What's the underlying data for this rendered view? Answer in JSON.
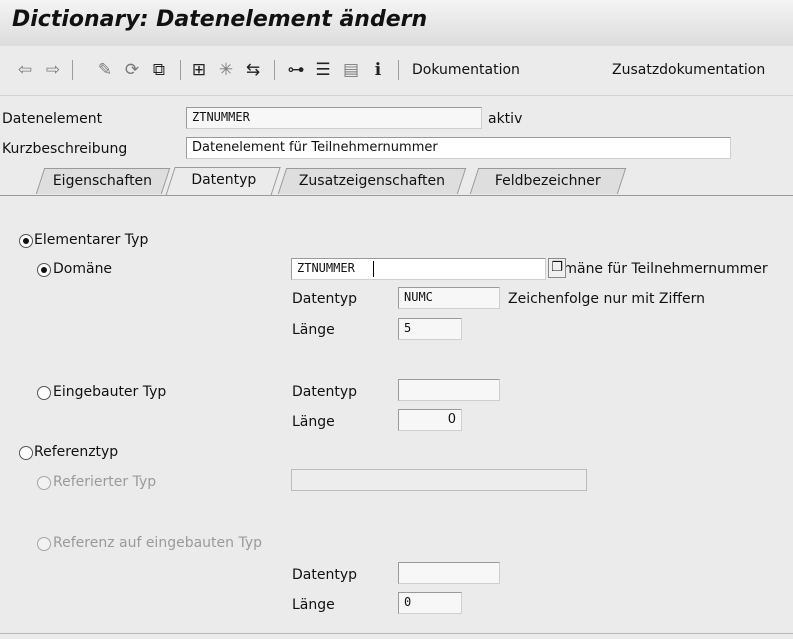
{
  "window": {
    "title": "Dictionary: Datenelement ändern"
  },
  "toolbar": {
    "icons": [
      "back-arrow-icon",
      "forward-arrow-icon",
      "display-change-icon",
      "active-inactive-icon",
      "other-object-icon",
      "check-icon",
      "activate-icon",
      "where-used-icon",
      "hierarchy-icon",
      "object-list-icon",
      "display-object-list-icon",
      "info-icon"
    ],
    "dokumentation_label": "Dokumentation",
    "zusatzdokumentation_label": "Zusatzdokumentation"
  },
  "header": {
    "datenelement_label": "Datenelement",
    "datenelement_value": "ZTNUMMER",
    "status": "aktiv",
    "kurzbeschreibung_label": "Kurzbeschreibung",
    "kurzbeschreibung_value": "Datenelement für Teilnehmernummer"
  },
  "tabs": [
    {
      "label": "Eigenschaften",
      "active": false
    },
    {
      "label": "Datentyp",
      "active": true
    },
    {
      "label": "Zusatzeigenschaften",
      "active": false
    },
    {
      "label": "Feldbezeichner",
      "active": false
    }
  ],
  "datatype": {
    "elementarer_typ": {
      "label": "Elementarer Typ",
      "selected": true
    },
    "domaene": {
      "label": "Domäne",
      "selected": true,
      "value": "ZTNUMMER",
      "description": "Domäne für Teilnehmernummer",
      "datentyp_label": "Datentyp",
      "datentyp_value": "NUMC",
      "datentyp_description": "Zeichenfolge nur mit Ziffern",
      "laenge_label": "Länge",
      "laenge_value": "5"
    },
    "eingebauter_typ": {
      "label": "Eingebauter Typ",
      "selected": false,
      "datentyp_label": "Datentyp",
      "datentyp_value": "",
      "laenge_label": "Länge",
      "laenge_value": "0"
    },
    "referenztyp": {
      "label": "Referenztyp",
      "selected": false
    },
    "referierter_typ": {
      "label": "Referierter Typ",
      "selected": false,
      "value": ""
    },
    "referenz_eingebaut": {
      "label": "Referenz auf eingebauten Typ",
      "selected": false,
      "datentyp_label": "Datentyp",
      "datentyp_value": "",
      "laenge_label": "Länge",
      "laenge_value": "0"
    }
  }
}
